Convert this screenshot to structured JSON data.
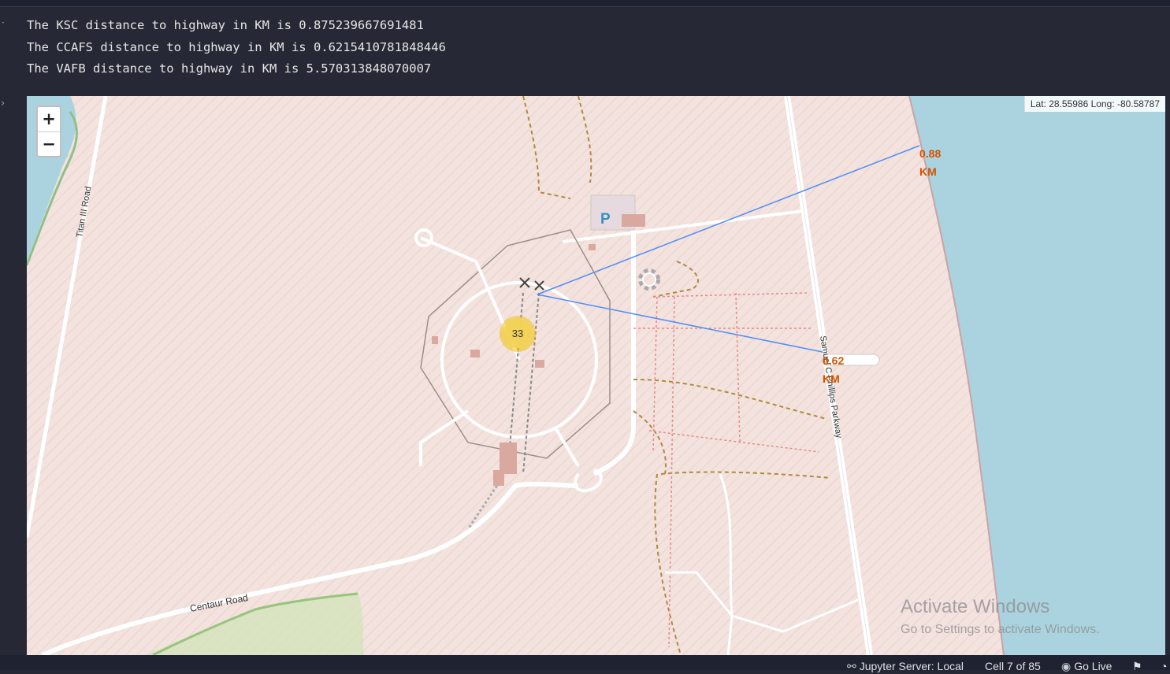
{
  "output_lines": [
    "The KSC distance to highway in KM is 0.875239667691481",
    "The CCAFS distance to highway in KM is 0.6215410781848446",
    "The VAFB distance to highway in KM is 5.570313848070007"
  ],
  "map": {
    "zoom_in": "+",
    "zoom_out": "−",
    "coordinates": "Lat: 28.55986 Long: -80.58787",
    "cluster_count": "33",
    "labels": {
      "dist_a_value": "0.88",
      "dist_a_unit": "KM",
      "dist_b_value": "0.62",
      "dist_b_unit": "KM"
    },
    "roads": {
      "titan": "Titan III Road",
      "centaur": "Centaur Road",
      "phillips": "Samuel C Phillips Parkway"
    },
    "parking": "P",
    "colors": {
      "land": "#f3e2dd",
      "water": "#aad3df",
      "line": "#4f8ef7",
      "label": "#d35400",
      "cluster": "#f1d357"
    }
  },
  "watermark": {
    "title": "Activate Windows",
    "subtitle": "Go to Settings to activate Windows."
  },
  "statusbar": {
    "server": "Jupyter Server: Local",
    "cell": "Cell 7 of 85",
    "golive": "Go Live"
  }
}
